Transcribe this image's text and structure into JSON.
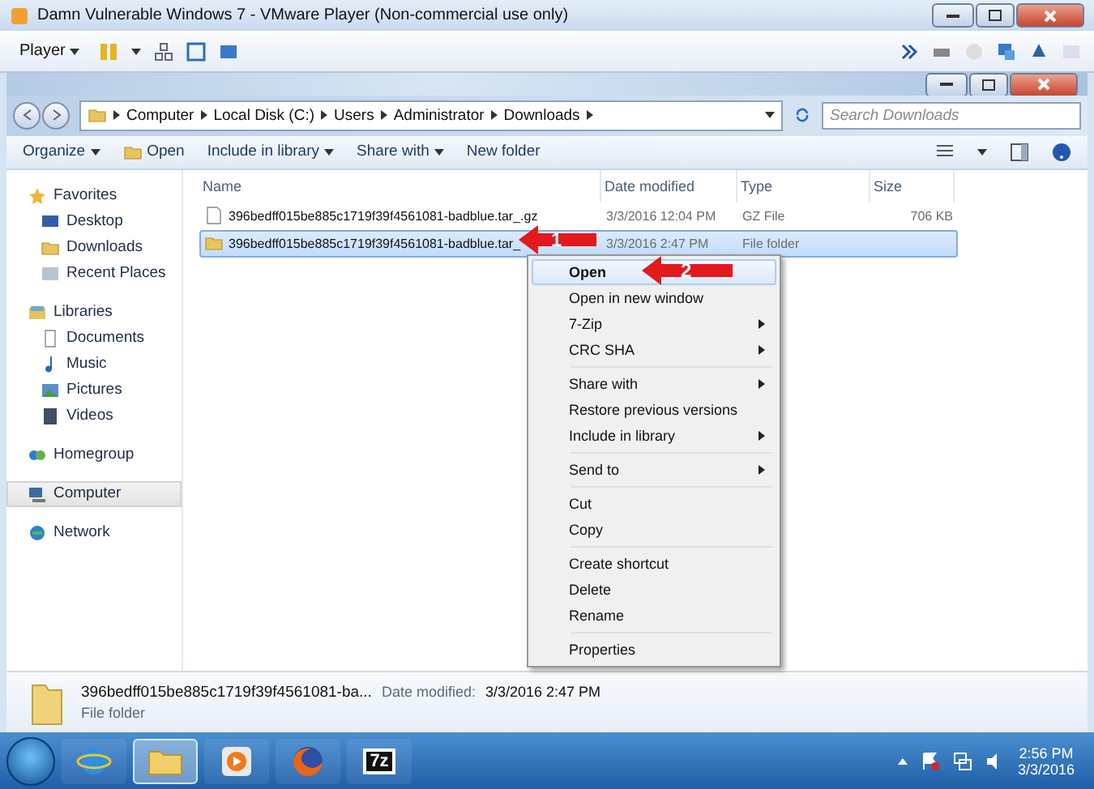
{
  "window": {
    "title": "Damn Vulnerable Windows 7 - VMware Player (Non-commercial use only)"
  },
  "player_toolbar": {
    "menu": "Player"
  },
  "address_bar": {
    "path": [
      "Computer",
      "Local Disk (C:)",
      "Users",
      "Administrator",
      "Downloads"
    ],
    "search": {
      "placeholder": "Search Downloads"
    }
  },
  "command_bar": [
    {
      "label": "Organize",
      "kind": "dropdown"
    },
    {
      "label": "Open",
      "kind": "open"
    },
    {
      "label": "Include in library",
      "kind": "dropdown"
    },
    {
      "label": "Share with",
      "kind": "dropdown"
    },
    {
      "label": "New folder",
      "kind": "plain"
    }
  ],
  "sidebar": {
    "items": [
      {
        "label": "Favorites",
        "selected": false,
        "children": [
          {
            "label": "Desktop",
            "selected": false
          },
          {
            "label": "Downloads",
            "selected": false
          },
          {
            "label": "Recent Places",
            "selected": false
          }
        ]
      },
      {
        "label": "Libraries",
        "selected": false,
        "children": [
          {
            "label": "Documents",
            "selected": false
          },
          {
            "label": "Music",
            "selected": false
          },
          {
            "label": "Pictures",
            "selected": false
          },
          {
            "label": "Videos",
            "selected": false
          }
        ]
      },
      {
        "label": "Homegroup",
        "selected": false
      },
      {
        "label": "Computer",
        "selected": true
      },
      {
        "label": "Network",
        "selected": false
      }
    ]
  },
  "table": {
    "columns": [
      "Name",
      "Date modified",
      "Type",
      "Size"
    ],
    "rows": [
      {
        "name": "396bedff015be885c1719f39f4561081-badblue.tar_.gz",
        "date": "3/3/2016 12:04 PM",
        "type": "GZ File",
        "size": "706 KB",
        "selected": false
      },
      {
        "name": "396bedff015be885c1719f39f4561081-badblue.tar_",
        "date": "3/3/2016 2:47 PM",
        "type": "File folder",
        "selected": true
      }
    ]
  },
  "context_menu": {
    "groups": [
      [
        {
          "label": "Open",
          "default": true,
          "selected": true,
          "submenu": false
        },
        {
          "label": "Open in new window",
          "default": false,
          "selected": false,
          "submenu": false
        },
        {
          "label": "7-Zip",
          "default": false,
          "selected": false,
          "submenu": true
        },
        {
          "label": "CRC SHA",
          "default": false,
          "selected": false,
          "submenu": true
        }
      ],
      [
        {
          "label": "Share with",
          "default": false,
          "selected": false,
          "submenu": true
        },
        {
          "label": "Restore previous versions",
          "default": false,
          "selected": false,
          "submenu": false
        },
        {
          "label": "Include in library",
          "default": false,
          "selected": false,
          "submenu": true
        }
      ],
      [
        {
          "label": "Send to",
          "default": false,
          "selected": false,
          "submenu": true
        }
      ],
      [
        {
          "label": "Cut",
          "default": false,
          "selected": false,
          "submenu": false
        },
        {
          "label": "Copy",
          "default": false,
          "selected": false,
          "submenu": false
        }
      ],
      [
        {
          "label": "Create shortcut",
          "default": false,
          "selected": false,
          "submenu": false
        },
        {
          "label": "Delete",
          "default": false,
          "selected": false,
          "submenu": false
        },
        {
          "label": "Rename",
          "default": false,
          "selected": false,
          "submenu": false
        }
      ],
      [
        {
          "label": "Properties",
          "default": false,
          "selected": false,
          "submenu": false
        }
      ]
    ]
  },
  "annotations": [
    {
      "label": "1"
    },
    {
      "label": "2"
    }
  ],
  "details_pane": {
    "name": "396bedff015be885c1719f39f4561081-ba...",
    "date_label": "Date modified:",
    "date": "3/3/2016 2:47 PM",
    "type": "File folder"
  },
  "taskbar": {
    "apps": [
      {
        "kind": "ie",
        "selected": false
      },
      {
        "kind": "explorer",
        "selected": true
      },
      {
        "kind": "media",
        "selected": false
      },
      {
        "kind": "firefox",
        "selected": false
      },
      {
        "kind": "sevenzip",
        "label": "7z",
        "selected": false
      }
    ],
    "time": "2:56 PM",
    "date": "3/3/2016"
  }
}
